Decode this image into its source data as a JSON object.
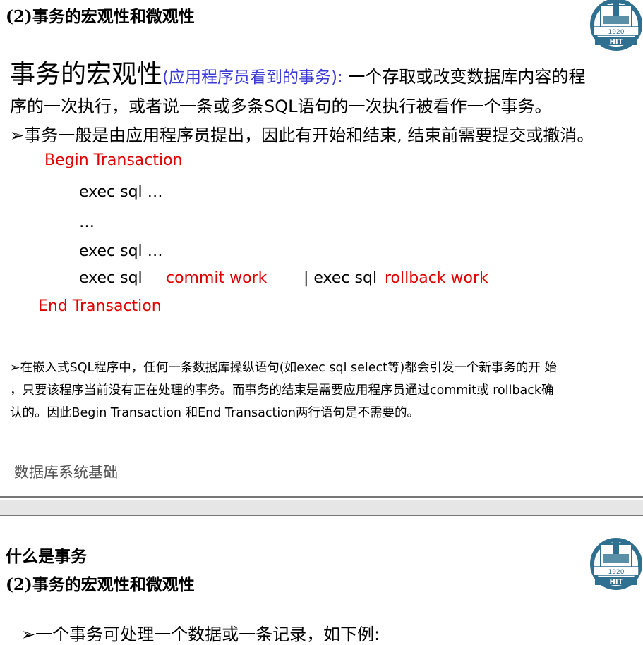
{
  "slide1": {
    "heading": "(2)事务的宏观性和微观性",
    "title_big": "事务的宏观性",
    "title_paren": "(应用程序员看到的事务):",
    "title_rest": " 一个存取或改变数据库内容的程",
    "line2": "序的一次执行，或者说一条或多条SQL语句的一次执行被看作一个事务。",
    "bullet1": "➢事务一般是由应用程序员提出，因此有开始和结束, 结束前需要提交或撤消。",
    "begin": "Begin  Transaction",
    "code1": "exec sql …",
    "code2": "…",
    "code3": "exec sql …",
    "code4a": "exec sql",
    "code4b": "commit work",
    "code4c": "|  exec sql",
    "code4d": "rollback work",
    "end": "End   Transaction",
    "para1": "➢在嵌入式SQL程序中，任何一条数据库操纵语句(如exec sql select等)都会引发一个新事务的开 始",
    "para2": "，只要该程序当前没有正在处理的事务。而事务的结束是需要应用程序员通过commit或 rollback确",
    "para3": "认的。因此Begin  Transaction 和End Transaction两行语句是不需要的。",
    "footer": "数据库系统基础",
    "logo_year": "1920",
    "logo_text": "HIT"
  },
  "slide2": {
    "heading1": "什么是事务",
    "heading2": "(2)事务的宏观性和微观性",
    "bullet1": "➢一个事务可处理一个数据或一条记录，如下例:",
    "logo_year": "1920",
    "logo_text": "HIT"
  },
  "colors": {
    "red": "#e00000",
    "blue": "#3b3bd6",
    "separator": "#888888"
  },
  "icons": [
    "hit-logo-icon"
  ]
}
